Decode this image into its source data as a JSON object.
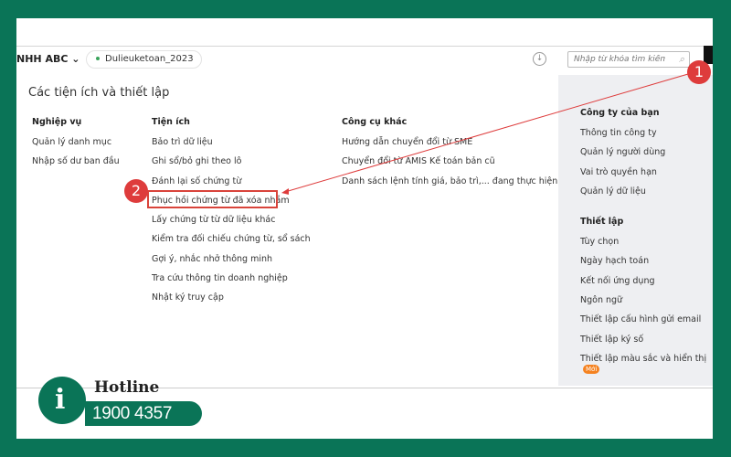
{
  "header": {
    "company": "NHH ABC",
    "database": "Dulieuketoan_2023",
    "search_placeholder": "Nhập từ khóa tìm kiếm"
  },
  "page_title": "Các tiện ích và thiết lập",
  "columns": [
    {
      "title": "Nghiệp vụ",
      "items": [
        "Quản lý danh mục",
        "Nhập số dư ban đầu"
      ]
    },
    {
      "title": "Tiện ích",
      "items": [
        "Bảo trì dữ liệu",
        "Ghi sổ/bỏ ghi theo lô",
        "Đánh lại số chứng từ",
        "Phục hồi chứng từ đã xóa nhầm",
        "Lấy chứng từ từ dữ liệu khác",
        "Kiểm tra đối chiếu chứng từ, sổ sách",
        "Gợi ý, nhắc nhở thông minh",
        "Tra cứu thông tin doanh nghiệp",
        "Nhật ký truy cập"
      ]
    },
    {
      "title": "Công cụ khác",
      "items": [
        "Hướng dẫn chuyển đổi từ SME",
        "Chuyển đổi từ AMIS Kế toán bản cũ",
        "Danh sách lệnh tính giá, bảo trì,... đang thực hiện"
      ]
    }
  ],
  "right_panel": {
    "company": {
      "title": "Công ty của bạn",
      "items": [
        "Thông tin công ty",
        "Quản lý người dùng",
        "Vai trò quyền hạn",
        "Quản lý dữ liệu"
      ]
    },
    "settings": {
      "title": "Thiết lập",
      "items": [
        "Tùy chọn",
        "Ngày hạch toán",
        "Kết nối ứng dụng",
        "Ngôn ngữ",
        "Thiết lập cấu hình gửi email",
        "Thiết lập ký số",
        "Thiết lập màu sắc và hiển thị"
      ],
      "new_badge": "Mới"
    }
  },
  "annotations": {
    "step1": "1",
    "step2": "2"
  },
  "hotline": {
    "label": "Hotline",
    "number": "1900 4357"
  },
  "colors": {
    "brand": "#0a7457",
    "annotation": "#de3c3c",
    "badge": "#f58220"
  }
}
